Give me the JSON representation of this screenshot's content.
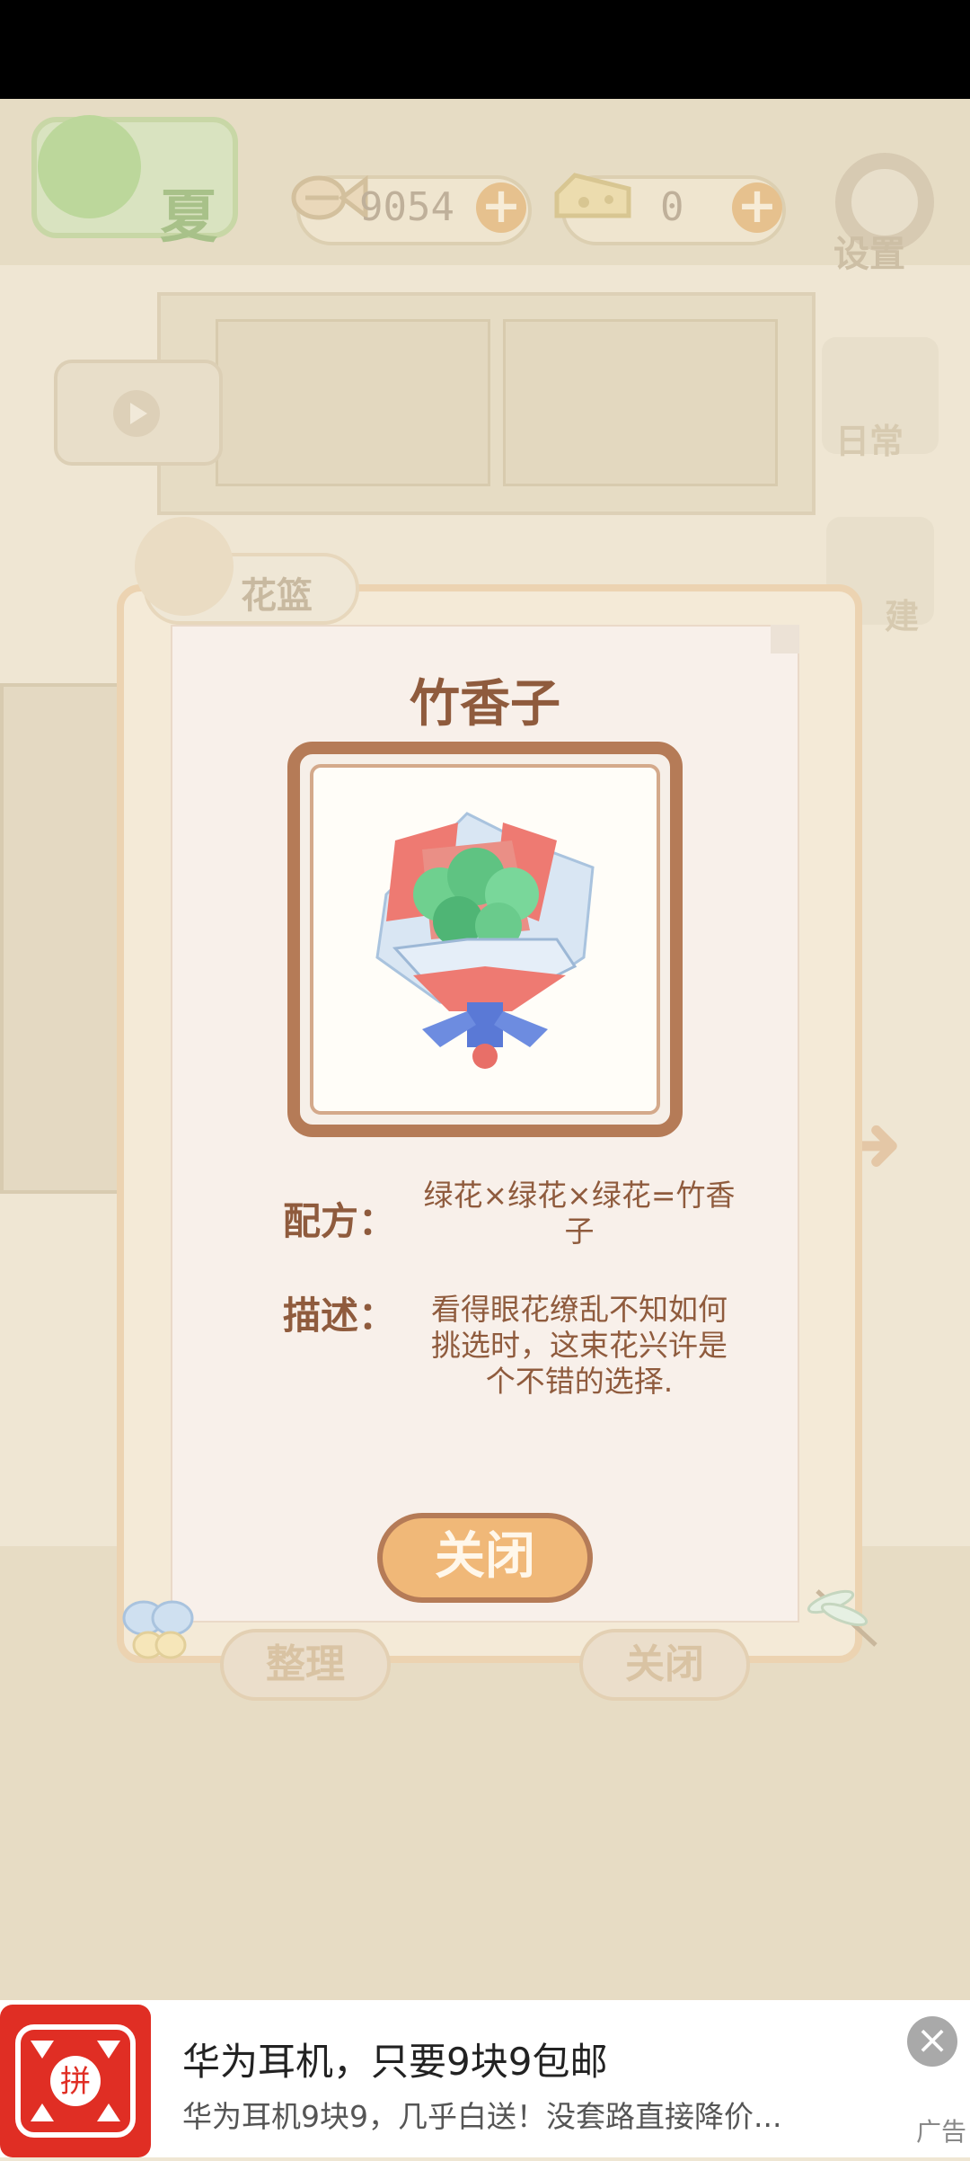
{
  "header": {
    "season_label": "夏",
    "fish_currency": "9054",
    "cheese_currency": "0",
    "plus_symbol": "+",
    "settings_label": "设置"
  },
  "room": {
    "daily_label": "日常",
    "build_label": "建"
  },
  "dialog": {
    "tab_label": "花篮",
    "item_title": "竹香子",
    "recipe_label": "配方：",
    "recipe_text": "绿花×绿花×绿花=竹香子",
    "desc_label": "描述：",
    "desc_text": "看得眼花缭乱不知如何挑选时，这束花兴许是个不错的选择.",
    "close_label": "关闭"
  },
  "bottom_buttons": {
    "sort_label": "整理",
    "close_label": "关闭"
  },
  "ad": {
    "title": "华为耳机，只要9块9包邮",
    "subtitle": "华为耳机9块9，几乎白送！没套路直接降价...",
    "close_symbol": "×",
    "tag": "广告",
    "logo_text": "拼"
  },
  "colors": {
    "title_brown": "#8f5b3d",
    "button_orange": "#f0b878",
    "ad_red": "#e02e24"
  }
}
